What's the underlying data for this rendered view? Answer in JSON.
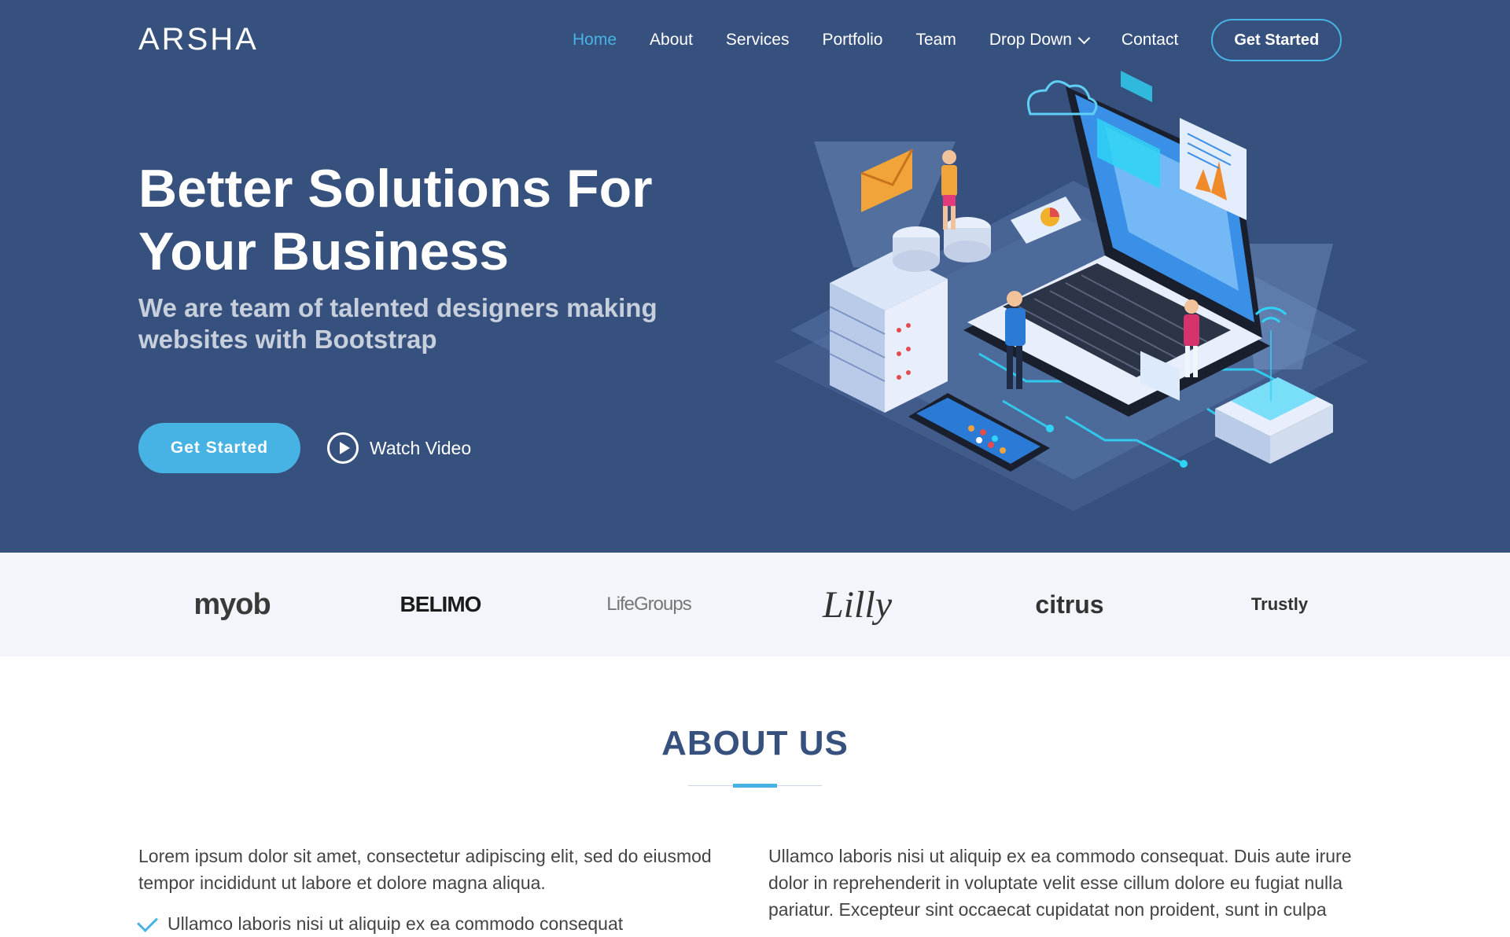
{
  "header": {
    "logo": "ARSHA",
    "nav": [
      {
        "label": "Home",
        "active": true
      },
      {
        "label": "About"
      },
      {
        "label": "Services"
      },
      {
        "label": "Portfolio"
      },
      {
        "label": "Team"
      },
      {
        "label": "Drop Down",
        "has_dropdown": true
      },
      {
        "label": "Contact"
      }
    ],
    "cta_label": "Get Started"
  },
  "hero": {
    "title": "Better Solutions For Your Business",
    "subtitle": "We are team of talented designers making websites with Bootstrap",
    "primary_button": "Get Started",
    "video_button": "Watch Video",
    "illustration": "isometric-laptop-servers-illustration"
  },
  "clients": [
    {
      "name": "myob",
      "icon": "myob-logo"
    },
    {
      "name": "BELIMO",
      "icon": "belimo-logo"
    },
    {
      "name": "LifeGroups",
      "icon": "lifegroups-logo"
    },
    {
      "name": "Lilly",
      "icon": "lilly-logo"
    },
    {
      "name": "citrus",
      "icon": "citrus-logo"
    },
    {
      "name": "Trustly",
      "icon": "trustly-logo"
    }
  ],
  "about": {
    "title": "ABOUT US",
    "left_text": "Lorem ipsum dolor sit amet, consectetur adipiscing elit, sed do eiusmod tempor incididunt ut labore et dolore magna aliqua.",
    "list": [
      "Ullamco laboris nisi ut aliquip ex ea commodo consequat"
    ],
    "right_text": "Ullamco laboris nisi ut aliquip ex ea commodo consequat. Duis aute irure dolor in reprehenderit in voluptate velit esse cillum dolore eu fugiat nulla pariatur. Excepteur sint occaecat cupidatat non proident, sunt in culpa"
  },
  "colors": {
    "hero_bg": "#37517e",
    "accent": "#47b2e4",
    "clients_bg": "#f3f5fa",
    "heading": "#37517e",
    "text": "#444444"
  }
}
